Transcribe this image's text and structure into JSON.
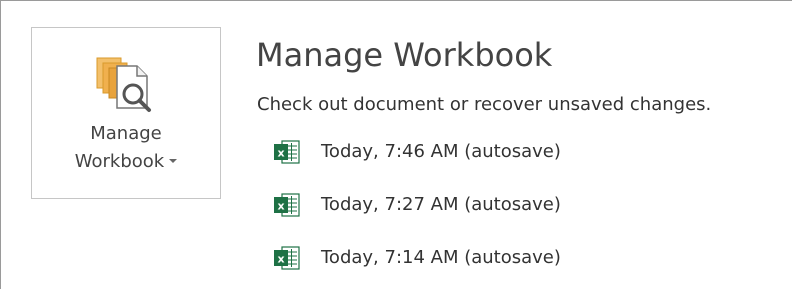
{
  "manage_button": {
    "line1": "Manage",
    "line2": "Workbook",
    "icon": "manage-workbook-icon"
  },
  "section": {
    "title": "Manage Workbook",
    "description": "Check out document or recover unsaved changes."
  },
  "versions": [
    {
      "label": "Today, 7:46 AM (autosave)",
      "icon": "excel-file-icon"
    },
    {
      "label": "Today, 7:27 AM (autosave)",
      "icon": "excel-file-icon"
    },
    {
      "label": "Today, 7:14 AM (autosave)",
      "icon": "excel-file-icon"
    }
  ],
  "colors": {
    "excel_green": "#1e7145",
    "doc_orange": "#e8a33d",
    "text": "#444444"
  }
}
